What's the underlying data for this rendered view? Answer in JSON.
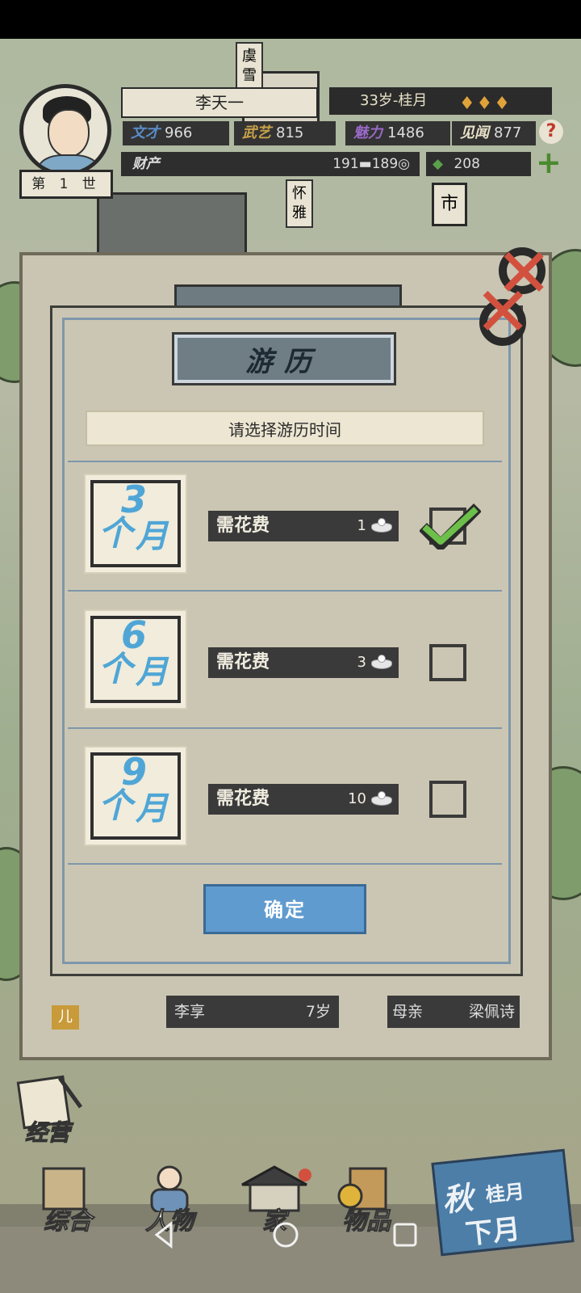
{
  "header": {
    "player_name": "李天一",
    "age_month": "33岁-桂月",
    "generation": "第 1 世",
    "stats": [
      {
        "label": "文才",
        "value": "966"
      },
      {
        "label": "武艺",
        "value": "815"
      },
      {
        "label": "魅力",
        "value": "1486"
      },
      {
        "label": "见闻",
        "value": "877"
      }
    ],
    "wealth_label": "财产",
    "silver": "191",
    "coins": "189",
    "jade": "208",
    "market_label": "市",
    "npc_tags": [
      "虞雪",
      "怀雅"
    ]
  },
  "dialog": {
    "title": "游历",
    "subtitle": "请选择游历时间",
    "options": [
      {
        "num": "3",
        "ge": "个",
        "yue": "月",
        "cost_label": "需花费",
        "cost": "1",
        "checked": true
      },
      {
        "num": "6",
        "ge": "个",
        "yue": "月",
        "cost_label": "需花费",
        "cost": "3",
        "checked": false
      },
      {
        "num": "9",
        "ge": "个",
        "yue": "月",
        "cost_label": "需花费",
        "cost": "10",
        "checked": false
      }
    ],
    "confirm_label": "确定"
  },
  "background_panel": {
    "child_badge": "儿",
    "child_name": "李享",
    "child_age": "7岁",
    "mother_label": "母亲",
    "mother_name": "梁佩诗"
  },
  "bottom_nav": {
    "jingying": "经营",
    "items": [
      "综合",
      "人物",
      "家",
      "物品"
    ],
    "season": "秋",
    "month": "桂月",
    "next_month": "下月"
  },
  "colors": {
    "accent_blue": "#5f9bcf",
    "check_green": "#6cc04a",
    "close_red": "#d2513e"
  }
}
